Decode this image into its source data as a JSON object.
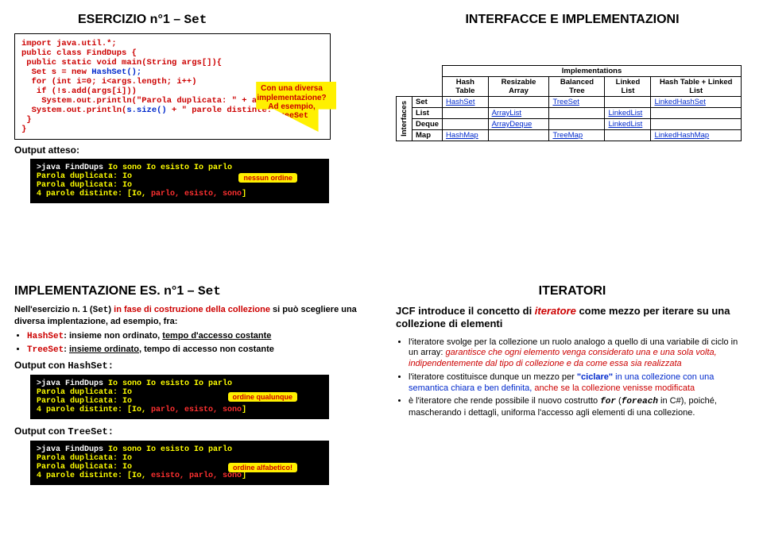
{
  "q1": {
    "title_prefix": "ESERCIZIO n°1 – ",
    "title_mono": "Set",
    "code": {
      "l1": "import java.util.*;",
      "l2": "public class FindDups {",
      "l3": " public static void main(String args[]){",
      "l4a": "  Set s = new ",
      "l4b": "HashSet();",
      "l5": "  for (int i=0; i<args.length; i++)",
      "l6": "   if (!s.add(args[i]))",
      "l7": "    System.out.println(\"Parola duplicata: \" + args[i]);",
      "l8a": "  System.out.println(",
      "l8b": "s.size()",
      "l8c": " + \" parole distinte: \"+",
      "l8d": "s",
      "l8e": ");",
      "l9": " }",
      "l10": "}"
    },
    "callout": {
      "l1": "Con una diversa",
      "l2": "implementazione?",
      "l3": "Ad esempio,",
      "l4": "TreeSet"
    },
    "out_label": "Output atteso:",
    "console": {
      "c1a": ">java FindDups ",
      "c1b": "Io sono Io esisto Io parlo",
      "c2a": "Parola duplicata: ",
      "c2b": "Io",
      "c3a": "Parola duplicata: ",
      "c3b": "Io",
      "c4a": "4 parole distinte: [Io, ",
      "c4b": "parlo, esisto, sono",
      "c4c": "]",
      "badge": "nessun ordine"
    }
  },
  "q2": {
    "title": "INTERFACCE E IMPLEMENTAZIONI",
    "table": {
      "imps": "Implementations",
      "ifs": "Interfaces",
      "cols": [
        "Hash Table",
        "Resizable Array",
        "Balanced Tree",
        "Linked List",
        "Hash Table + Linked List"
      ],
      "rows": [
        {
          "h": "Set",
          "c": [
            "HashSet",
            "",
            "TreeSet",
            "",
            "LinkedHashSet"
          ]
        },
        {
          "h": "List",
          "c": [
            "",
            "ArrayList",
            "",
            "LinkedList",
            ""
          ]
        },
        {
          "h": "Deque",
          "c": [
            "",
            "ArrayDeque",
            "",
            "LinkedList",
            ""
          ]
        },
        {
          "h": "Map",
          "c": [
            "HashMap",
            "",
            "TreeMap",
            "",
            "LinkedHashMap"
          ]
        }
      ]
    }
  },
  "q3": {
    "title_prefix": "IMPLEMENTAZIONE ES. n°1 – ",
    "title_mono": "Set",
    "intro_a": "Nell'esercizio n. 1 (",
    "intro_mono": "Set",
    "intro_b": ") ",
    "intro_red": "in fase di costruzione della collezione",
    "intro_c": " si può scegliere una diversa implentazione, ad esempio, fra:",
    "b1_mono": "HashSet",
    "b1_txt": ": insieme non ordinato, ",
    "b1_u": "tempo d'accesso costante",
    "b2_mono": "TreeSet",
    "b2_txt": ": ",
    "b2_u": "insieme ordinato",
    "b2_txt2": ", tempo di accesso non costante",
    "out1_label": "Output con ",
    "out1_mono": "HashSet:",
    "cons1": {
      "c1a": ">java FindDups ",
      "c1b": "Io sono Io esisto Io parlo",
      "c2a": "Parola duplicata: ",
      "c2b": "Io",
      "c3a": "Parola duplicata: ",
      "c3b": "Io",
      "c4a": "4 parole distinte: [Io, ",
      "c4b": "parlo, esisto, sono",
      "c4c": "]",
      "badge": "ordine qualunque"
    },
    "out2_label": "Output con ",
    "out2_mono": "TreeSet:",
    "cons2": {
      "c1a": ">java FindDups ",
      "c1b": "Io sono Io esisto Io parlo",
      "c2a": "Parola duplicata: ",
      "c2b": "Io",
      "c3a": "Parola duplicata: ",
      "c3b": "Io",
      "c4a": "4 parole distinte: [Io, ",
      "c4b": "esisto, parlo, sono",
      "c4c": "]",
      "badge": "ordine alfabetico!"
    }
  },
  "q4": {
    "title": "ITERATORI",
    "p1a": "JCF introduce il concetto di ",
    "p1b": "iteratore",
    "p1c": " come mezzo per iterare su una collezione di elementi",
    "b1a": "l'iteratore svolge per la collezione un ruolo analogo a quello di una variabile di ciclo in un array: ",
    "b1b": "garantisce che ogni elemento venga considerato una e una sola volta, indipendentemente dal tipo di collezione e da come essa sia realizzata",
    "b2a": "l'iteratore costituisce dunque un mezzo per ",
    "b2b": "\"ciclare\"",
    "b2c": " in una collezione con una semantica chiara e ben definita, ",
    "b2d": "anche se la collezione venisse modificata",
    "b3a": "è l'iteratore che rende possibile il nuovo costrutto ",
    "b3b": "for",
    "b3c": " (",
    "b3d": "foreach",
    "b3e": " in C#), poiché, mascherando i dettagli, uniforma l'accesso agli elementi di una collezione."
  }
}
